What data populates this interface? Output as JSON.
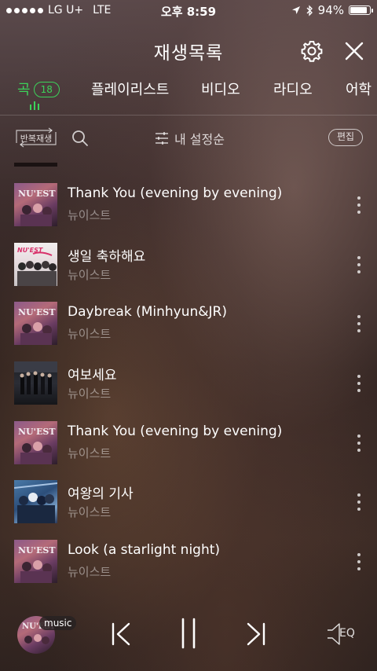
{
  "status_bar": {
    "carrier": "LG U+",
    "network": "LTE",
    "time": "오후 8:59",
    "battery": "94%",
    "battery_level": 0.94
  },
  "header": {
    "title": "재생목록"
  },
  "tabs": [
    {
      "label": "곡",
      "badge": "18",
      "active": true
    },
    {
      "label": "플레이리스트"
    },
    {
      "label": "비디오"
    },
    {
      "label": "라디오"
    },
    {
      "label": "어학"
    }
  ],
  "toolbar": {
    "repeat_label": "반복재생",
    "sort_label": "내 설정순",
    "edit_label": "편집"
  },
  "songs": [
    {
      "title": "Thank You (evening by evening)",
      "artist": "뉴이스트"
    },
    {
      "title": "생일 축하해요",
      "artist": "뉴이스트"
    },
    {
      "title": "Daybreak (Minhyun&JR)",
      "artist": "뉴이스트"
    },
    {
      "title": "여보세요",
      "artist": "뉴이스트"
    },
    {
      "title": "Thank You (evening by evening)",
      "artist": "뉴이스트"
    },
    {
      "title": "여왕의 기사",
      "artist": "뉴이스트"
    },
    {
      "title": "Look (a starlight night)",
      "artist": "뉴이스트"
    }
  ],
  "album_art_text": {
    "nuest": "NU'EST",
    "bday": "NU'EST"
  },
  "player": {
    "badge": "music",
    "eq_label": "EQ"
  },
  "colors": {
    "accent": "#3cd25a"
  }
}
